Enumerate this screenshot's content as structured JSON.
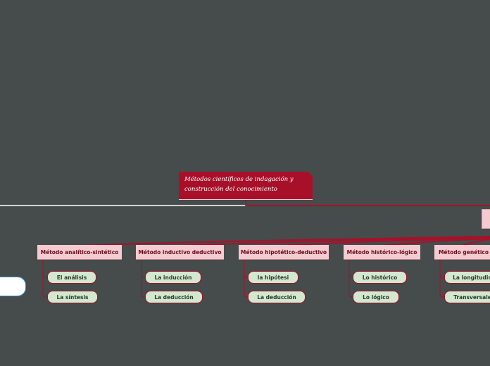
{
  "central": {
    "title": "Métodos científicos de indagación y construcción del conocimiento"
  },
  "methods": [
    {
      "label": "Método analítico-sintético",
      "children": [
        "El análisis",
        "La síntesis"
      ]
    },
    {
      "label": "Método inductivo deductivo",
      "children": [
        "La inducción",
        "La deducción"
      ]
    },
    {
      "label": "Método hipotético-deductivo",
      "children": [
        "la hipótesi",
        "La deducción"
      ]
    },
    {
      "label": "Método histórico-lógico",
      "children": [
        "Lo histórico",
        "Lo lógico"
      ]
    },
    {
      "label": "Método genético",
      "children": [
        "La longitudin",
        "Transversale"
      ]
    }
  ],
  "colors": {
    "background": "#464b4b",
    "central": "#a8102a",
    "method": "#f3cbd0",
    "leaf": "#d3e8cf",
    "connector": "#a8102a"
  }
}
